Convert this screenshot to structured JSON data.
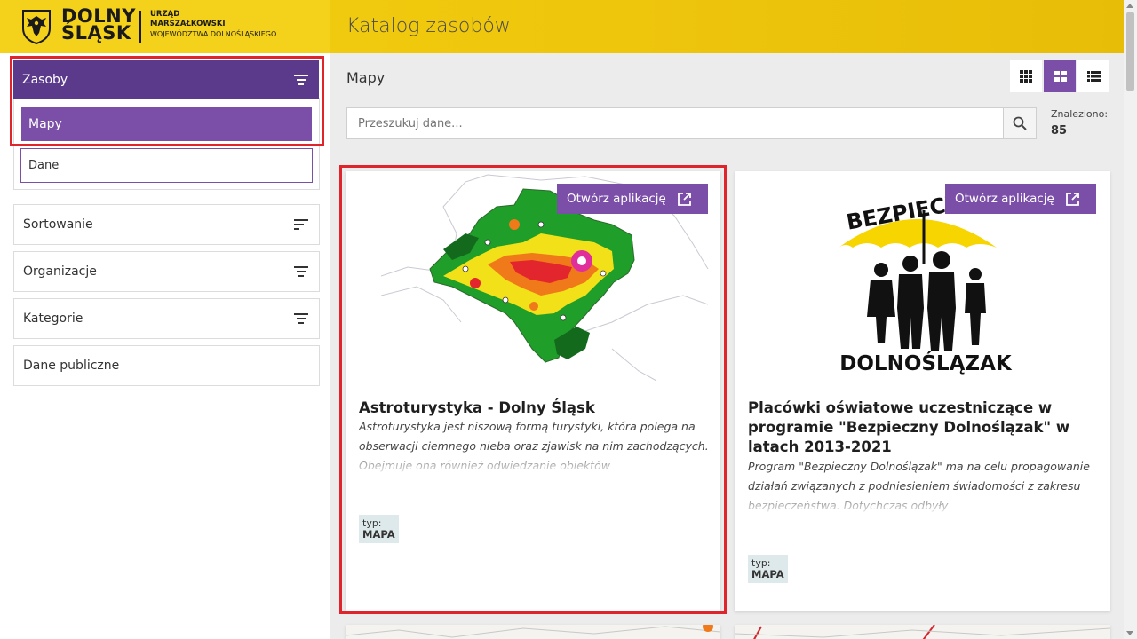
{
  "header": {
    "brand_line1": "DOLNY",
    "brand_line2": "ŚLĄSK",
    "sub_line1": "URZĄD",
    "sub_line2": "MARSZAŁKOWSKI",
    "sub_line3": "WOJEWÓDZTWA DOLNOŚLĄSKIEGO",
    "app_title": "Katalog zasobów"
  },
  "sidebar": {
    "resources_label": "Zasoby",
    "option_maps": "Mapy",
    "option_data": "Dane",
    "sorting": "Sortowanie",
    "organizations": "Organizacje",
    "categories": "Kategorie",
    "public_data": "Dane publiczne"
  },
  "main": {
    "breadcrumb": "Mapy",
    "search_placeholder": "Przeszukuj dane...",
    "found_label": "Znaleziono:",
    "found_count": "85"
  },
  "cards": [
    {
      "open_button": "Otwórz aplikację",
      "title": "Astroturystyka - Dolny Śląsk",
      "description": "Astroturystyka jest niszową formą turystyki, która polega na obserwacji ciemnego nieba oraz zjawisk na nim zachodzących. Obejmuje ona również odwiedzanie obiektów",
      "type_label": "typ:",
      "type_value": "MAPA"
    },
    {
      "open_button": "Otwórz aplikację",
      "logo_top": "BEZPIECZNY",
      "logo_bottom": "DOLNOŚLĄZAK",
      "title": "Placówki oświatowe uczestniczące w programie \"Bezpieczny Dolnoślązak\" w latach 2013-2021",
      "description": "Program \"Bezpieczny Dolnoślązak\" ma na celu propagowanie działań związanych z podniesieniem świadomości z zakresu bezpieczeństwa. Dotychczas odbyły",
      "type_label": "typ:",
      "type_value": "MAPA"
    }
  ],
  "colors": {
    "header_yellow": "#f3cf10",
    "purple_dark": "#5b3a8c",
    "purple": "#7b4fa8",
    "highlight_red": "#e0242c"
  }
}
